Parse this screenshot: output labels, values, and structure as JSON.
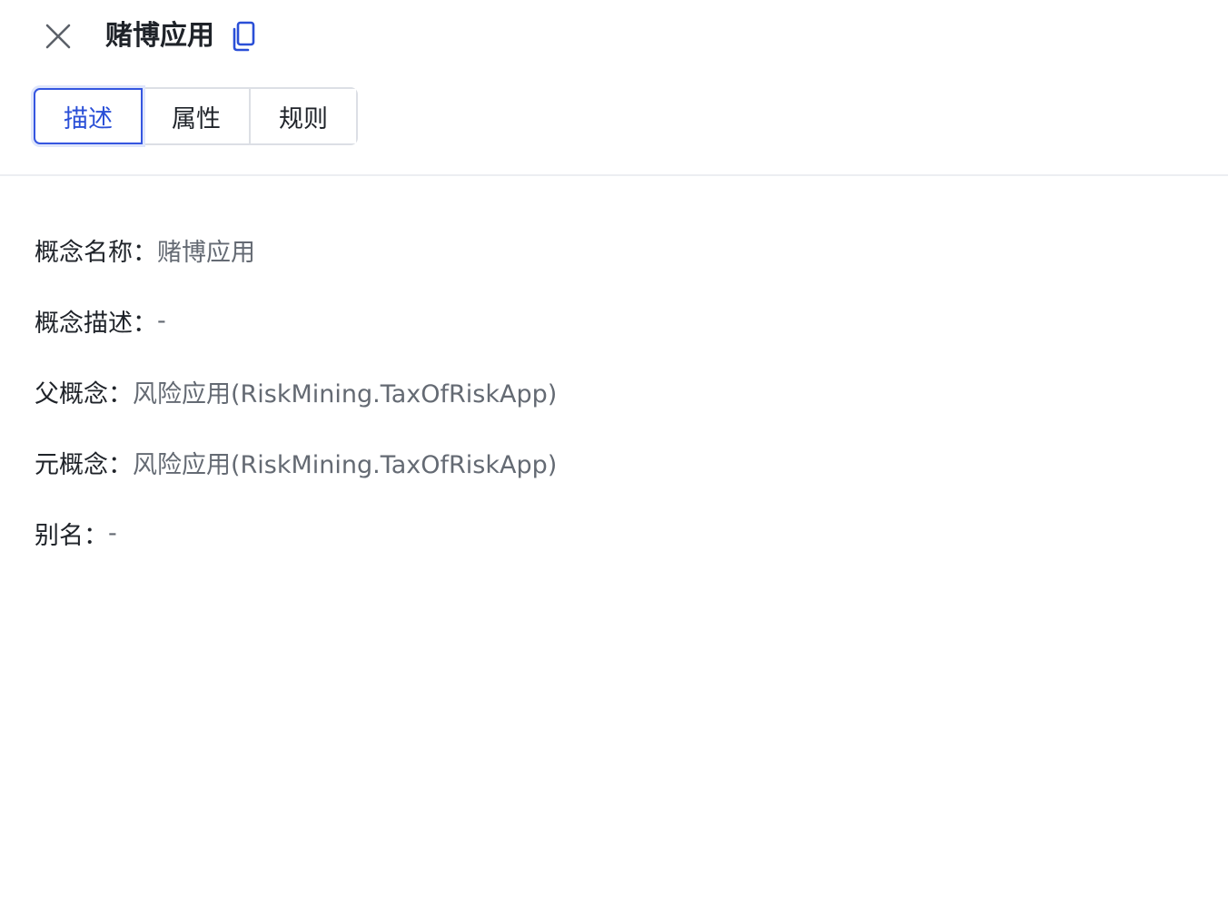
{
  "header": {
    "title": "赌博应用",
    "close_icon": "close-icon",
    "copy_icon": "copy-icon",
    "accent_color": "#2a4fd7"
  },
  "tabs": [
    {
      "label": "描述",
      "active": true
    },
    {
      "label": "属性",
      "active": false
    },
    {
      "label": "规则",
      "active": false
    }
  ],
  "details": [
    {
      "label": "概念名称：",
      "value": "赌博应用"
    },
    {
      "label": "概念描述：",
      "value": "-"
    },
    {
      "label": "父概念：",
      "value": "风险应用(RiskMining.TaxOfRiskApp)"
    },
    {
      "label": "元概念：",
      "value": "风险应用(RiskMining.TaxOfRiskApp)"
    },
    {
      "label": "别名：",
      "value": "-"
    }
  ]
}
